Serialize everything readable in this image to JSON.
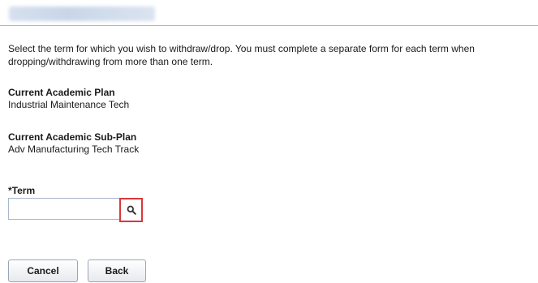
{
  "header": {
    "title_blurred": ""
  },
  "instructions": "Select the term for which you wish to withdraw/drop. You must complete a separate form for each term when dropping/withdrawing from more than one term.",
  "academic_plan": {
    "label": "Current Academic Plan",
    "value": "Industrial Maintenance Tech"
  },
  "academic_subplan": {
    "label": "Current Academic Sub-Plan",
    "value": "Adv Manufacturing Tech Track"
  },
  "term": {
    "label": "*Term",
    "value": "",
    "lookup_icon": "search-icon"
  },
  "buttons": {
    "cancel": "Cancel",
    "back": "Back"
  },
  "colors": {
    "lookup_highlight": "#d9383b",
    "rule": "#a9b7cc"
  }
}
